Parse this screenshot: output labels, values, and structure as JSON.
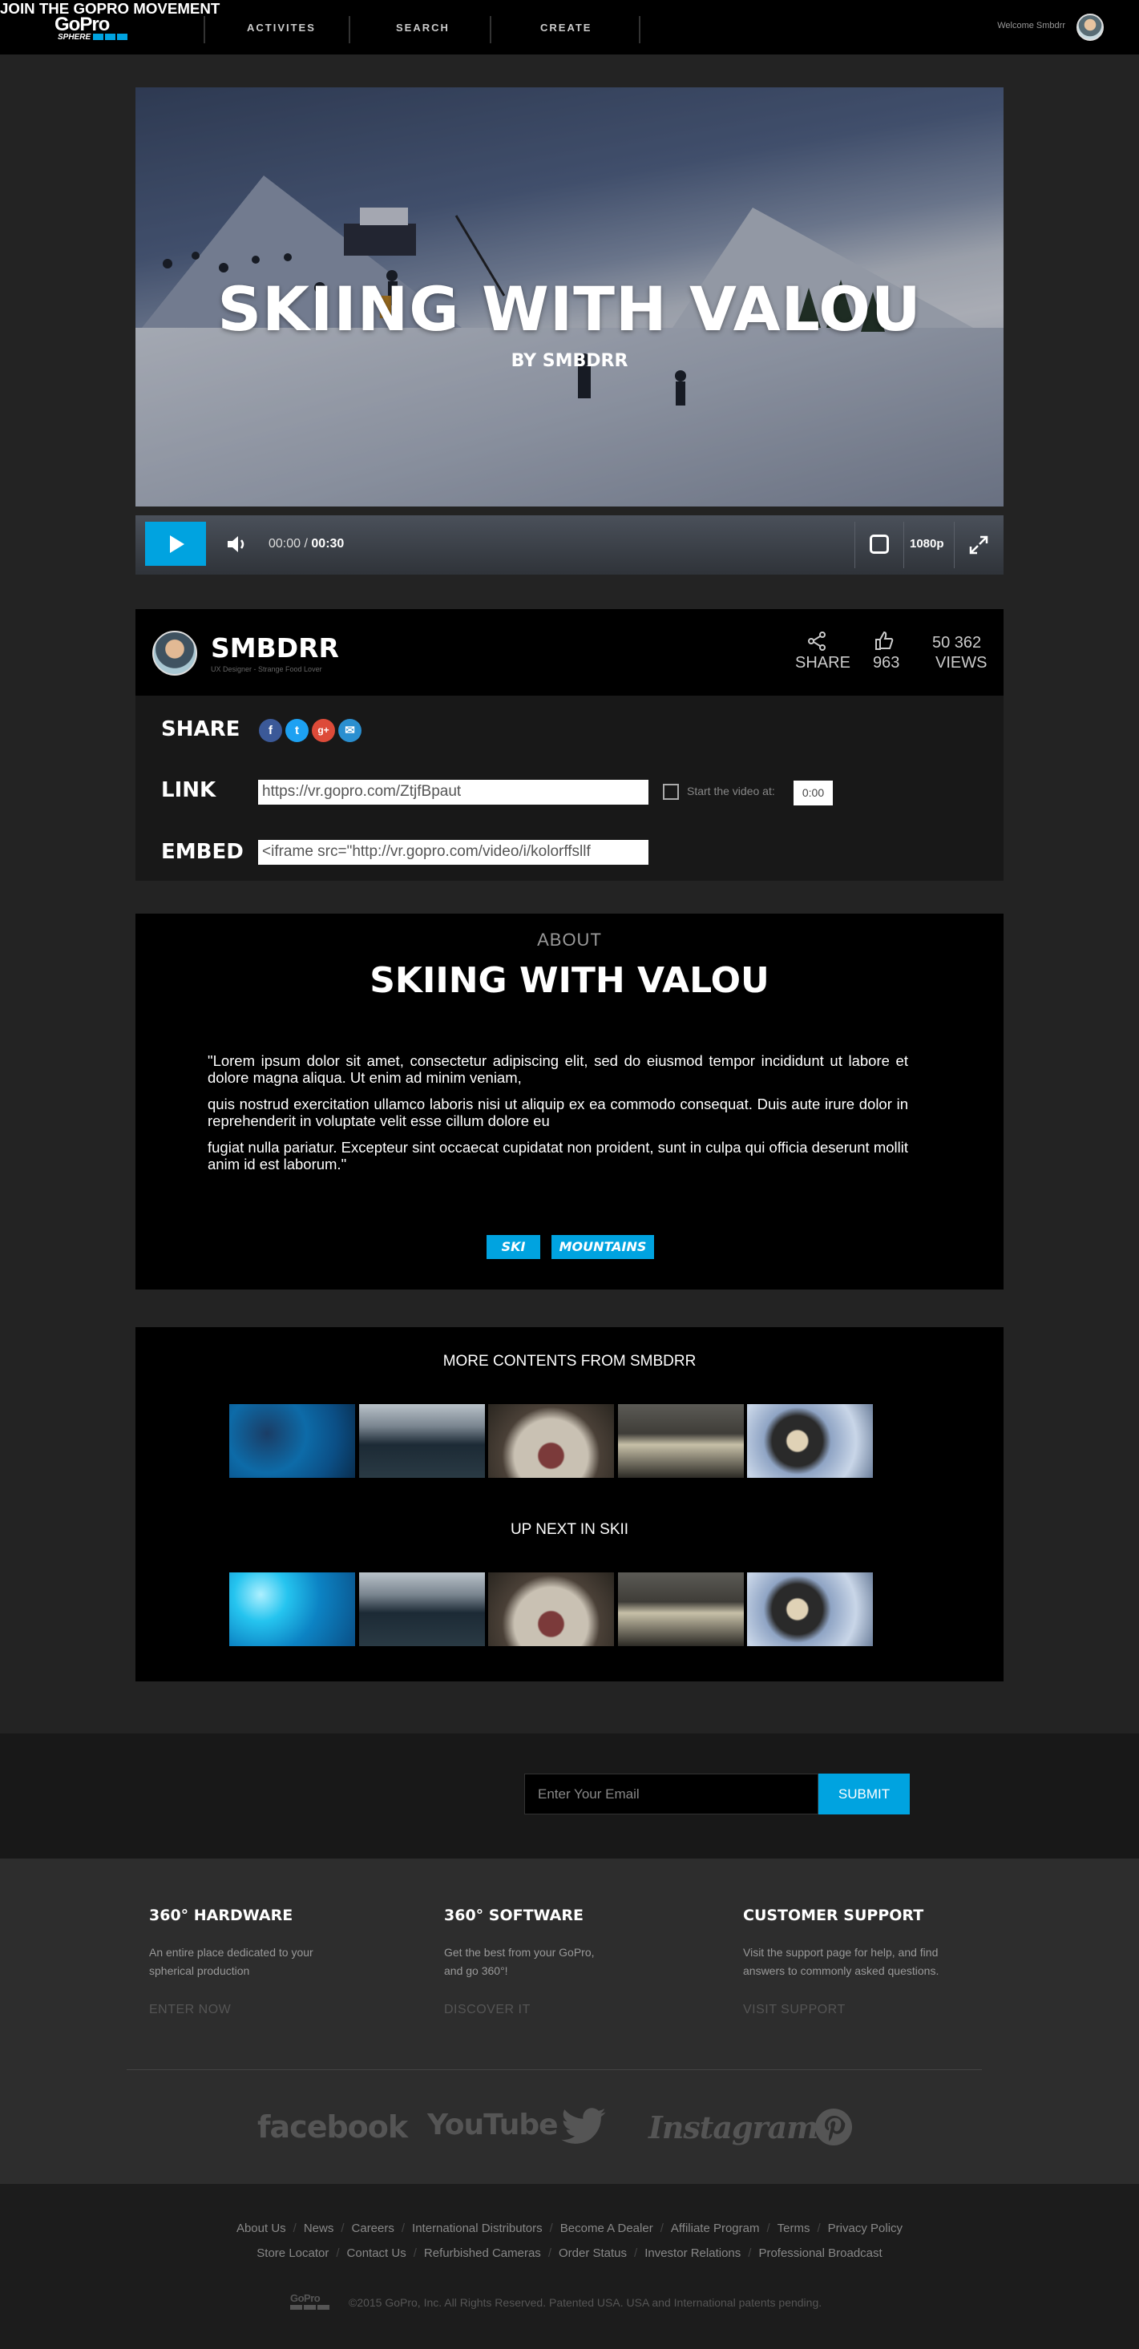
{
  "nav": {
    "logo": {
      "text": "GoPro",
      "sub": "SPHERE"
    },
    "items": [
      "ACTIVITES",
      "SEARCH",
      "CREATE"
    ],
    "welcome": "Welcome Smbdrr"
  },
  "video": {
    "title": "SKIING WITH VALOU",
    "byline": "BY SMBDRR",
    "current_time": "00:00 /",
    "duration": "00:30",
    "quality": "1080p"
  },
  "author": {
    "name": "SMBDRR",
    "tagline": "UX Designer - Strange Food Lover",
    "share_label": "SHARE",
    "likes": "963",
    "views_count": "50 362",
    "views_label": "VIEWS"
  },
  "share": {
    "share_label": "SHARE",
    "link_label": "LINK",
    "embed_label": "EMBED",
    "link_value": "https://vr.gopro.com/ZtjfBpaut",
    "embed_value": "<iframe src=\"http://vr.gopro.com/video/i/kolorffsllf",
    "start_label": "Start the video at:",
    "start_value": "0:00",
    "icons": [
      "f",
      "t",
      "g+",
      "✉"
    ]
  },
  "about": {
    "caption": "ABOUT",
    "title": "SKIING WITH VALOU",
    "paragraphs": [
      "\"Lorem ipsum dolor sit amet, consectetur adipiscing elit, sed do eiusmod tempor incididunt ut labore et dolore magna aliqua. Ut enim ad minim veniam,",
      "quis nostrud exercitation ullamco laboris nisi ut aliquip ex ea commodo consequat. Duis aute irure dolor in reprehenderit in voluptate velit esse cillum dolore eu",
      "fugiat nulla pariatur. Excepteur sint occaecat cupidatat non proident, sunt in culpa qui officia deserunt mollit anim id est laborum.\""
    ],
    "tags": [
      "SKI",
      "MOUNTAINS"
    ]
  },
  "more": {
    "heading1": "MORE CONTENTS FROM SMBDRR",
    "heading2": "UP NEXT IN SKII"
  },
  "newsletter": {
    "heading": "JOIN THE GOPRO MOVEMENT",
    "placeholder": "Enter Your Email",
    "submit": "SUBMIT"
  },
  "footer": {
    "columns": [
      {
        "title": "360° HARDWARE",
        "text": "An entire place dedicated to your spherical production",
        "link": "ENTER NOW"
      },
      {
        "title": "360° SOFTWARE",
        "text": "Get the best from your GoPro, and go 360°!",
        "link": "DISCOVER IT"
      },
      {
        "title": "CUSTOMER SUPPORT",
        "text": "Visit the support page for help, and find answers to commonly asked questions.",
        "link": "VISIT SUPPORT"
      }
    ],
    "social": [
      "facebook",
      "YouTube",
      "Instagram"
    ],
    "links_row1": [
      "About Us",
      "News",
      "Careers",
      "International Distributors",
      "Become A Dealer",
      "Affiliate Program",
      "Terms",
      "Privacy Policy"
    ],
    "links_row2": [
      "Store Locator",
      "Contact Us",
      "Refurbished Cameras",
      "Order Status",
      "Investor Relations",
      "Professional Broadcast"
    ],
    "copyright": "©2015 GoPro, Inc. All Rights Reserved. Patented USA. USA and International patents pending.",
    "logo_text": "GoPro"
  }
}
